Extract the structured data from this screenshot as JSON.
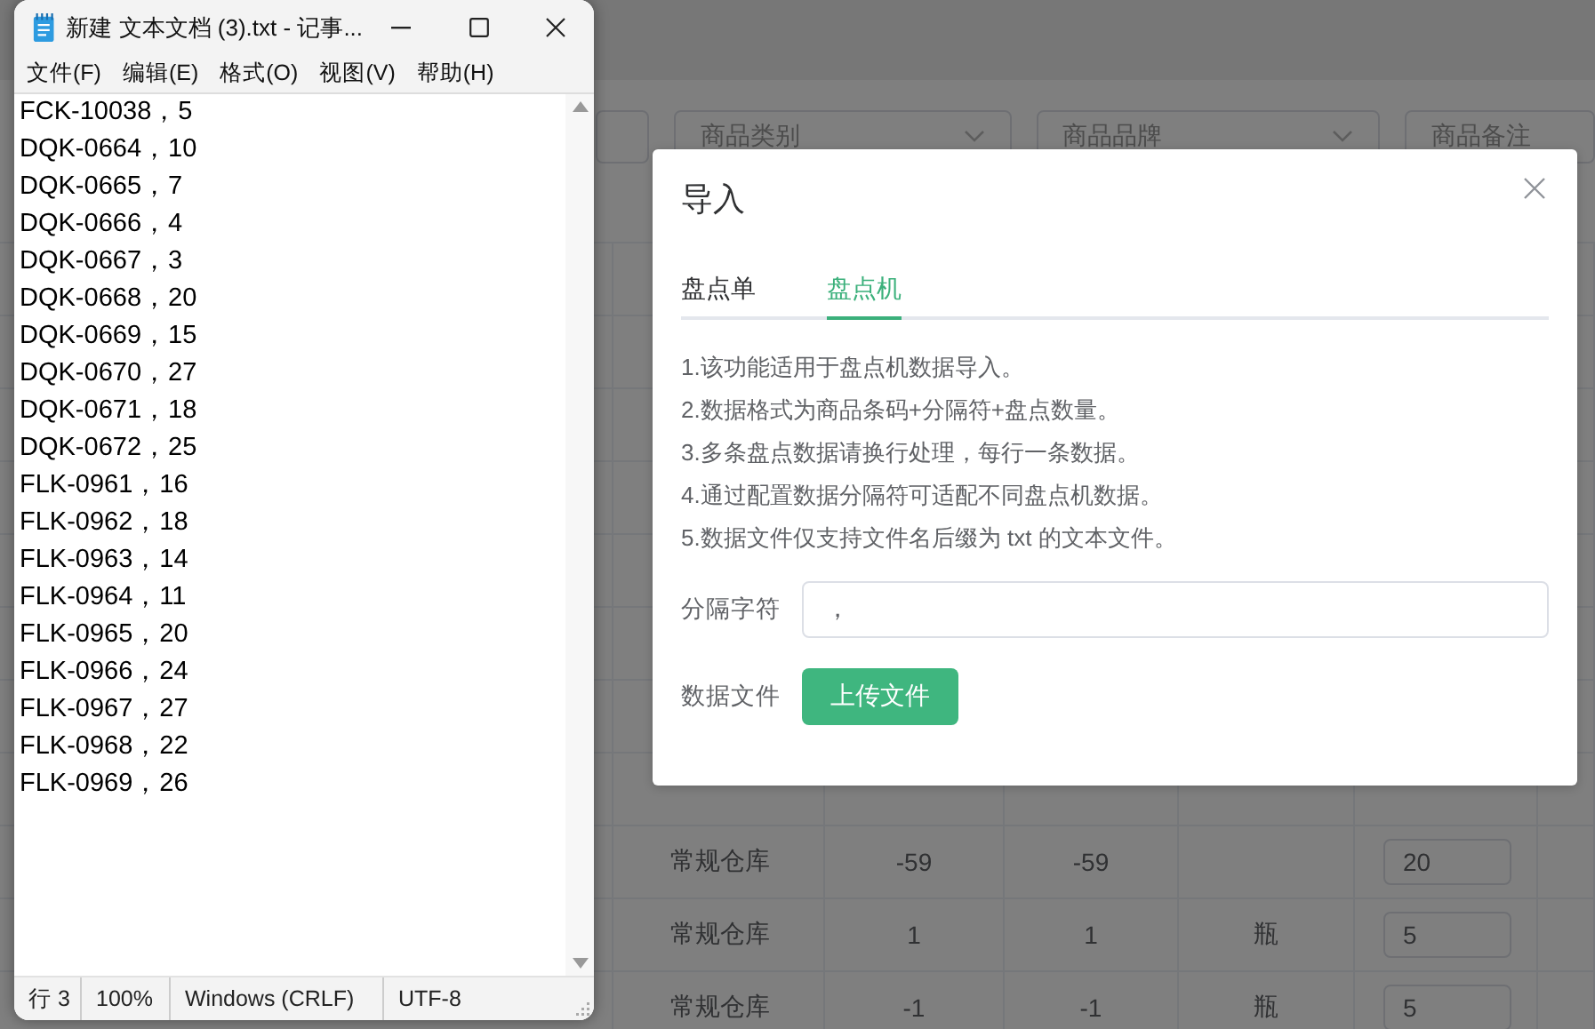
{
  "background": {
    "filters": [
      {
        "placeholder": "商品类别",
        "kind": "select"
      },
      {
        "placeholder": "商品品牌",
        "kind": "select"
      },
      {
        "placeholder": "商品备注",
        "kind": "input"
      }
    ],
    "table": {
      "rows": [
        {
          "warehouse": "常规仓库",
          "column_2": "-59",
          "column_3": "-59",
          "quantity": "20"
        },
        {
          "warehouse": "常规仓库",
          "column_2": "1",
          "column_3": "1",
          "unit": "瓶",
          "quantity": "5"
        },
        {
          "warehouse": "常规仓库",
          "column_2": "-1",
          "column_3": "-1",
          "unit": "瓶",
          "quantity": "5"
        }
      ]
    }
  },
  "notepad": {
    "title": "新建 文本文档 (3).txt - 记事...",
    "menu": [
      "文件(F)",
      "编辑(E)",
      "格式(O)",
      "视图(V)",
      "帮助(H)"
    ],
    "lines": [
      "FCK-10038，5",
      "DQK-0664，10",
      "DQK-0665，7",
      "DQK-0666，4",
      "DQK-0667，3",
      "DQK-0668，20",
      "DQK-0669，15",
      "DQK-0670，27",
      "DQK-0671，18",
      "DQK-0672，25",
      "FLK-0961，16",
      "FLK-0962，18",
      "FLK-0963，14",
      "FLK-0964，11",
      "FLK-0965，20",
      "FLK-0966，24",
      "FLK-0967，27",
      "FLK-0968，22",
      "FLK-0969，26"
    ],
    "status": [
      "行 3",
      "100%",
      "Windows (CRLF)",
      "UTF-8"
    ]
  },
  "dialog": {
    "title": "导入",
    "tabs": [
      {
        "label": "盘点单",
        "selected": false
      },
      {
        "label": "盘点机",
        "selected": true
      }
    ],
    "notes": [
      "1.该功能适用于盘点机数据导入。",
      "2.数据格式为商品条码+分隔符+盘点数量。",
      "3.多条盘点数据请换行处理，每行一条数据。",
      "4.通过配置数据分隔符可适配不同盘点机数据。",
      "5.数据文件仅支持文件名后缀为 txt 的文本文件。"
    ],
    "separator": {
      "label": "分隔字符",
      "value": "，"
    },
    "file": {
      "label": "数据文件",
      "button": "上传文件"
    }
  }
}
